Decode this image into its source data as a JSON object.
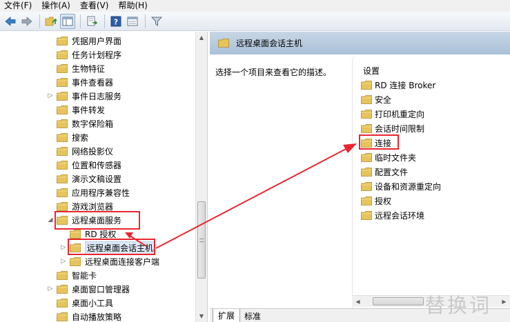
{
  "menu": [
    "文件(F)",
    "操作(A)",
    "查看(V)",
    "帮助(H)"
  ],
  "toolbar": {
    "icons": [
      "back-arrow-icon",
      "forward-arrow-icon",
      "up-folder-icon",
      "show-hide-tree-icon",
      "export-list-icon",
      "help-icon",
      "properties-icon",
      "filter-icon"
    ]
  },
  "tree": {
    "items": [
      {
        "label": "凭据用户界面",
        "expander": ""
      },
      {
        "label": "任务计划程序",
        "expander": ""
      },
      {
        "label": "生物特征",
        "expander": ""
      },
      {
        "label": "事件查看器",
        "expander": ""
      },
      {
        "label": "事件日志服务",
        "expander": "▷"
      },
      {
        "label": "事件转发",
        "expander": ""
      },
      {
        "label": "数字保险箱",
        "expander": ""
      },
      {
        "label": "搜索",
        "expander": ""
      },
      {
        "label": "网络投影仪",
        "expander": ""
      },
      {
        "label": "位置和传感器",
        "expander": ""
      },
      {
        "label": "演示文稿设置",
        "expander": ""
      },
      {
        "label": "应用程序兼容性",
        "expander": ""
      },
      {
        "label": "游戏浏览器",
        "expander": ""
      },
      {
        "label": "远程桌面服务",
        "expander": "◢"
      },
      {
        "label": "RD 授权",
        "expander": ""
      },
      {
        "label": "远程桌面会话主机",
        "expander": "▷"
      },
      {
        "label": "远程桌面连接客户端",
        "expander": "▷"
      },
      {
        "label": "智能卡",
        "expander": ""
      },
      {
        "label": "桌面窗口管理器",
        "expander": "▷"
      },
      {
        "label": "桌面小工具",
        "expander": ""
      },
      {
        "label": "自动播放策略",
        "expander": ""
      }
    ]
  },
  "header": {
    "title": "远程桌面会话主机"
  },
  "description": "选择一个项目来查看它的描述。",
  "settings": {
    "heading": "设置",
    "items": [
      "RD 连接 Broker",
      "安全",
      "打印机重定向",
      "会话时间限制",
      "连接",
      "临时文件夹",
      "配置文件",
      "设备和资源重定向",
      "授权",
      "远程会话环境"
    ]
  },
  "tabs": [
    "扩展",
    "标准"
  ],
  "watermark": "替换词",
  "colors": {
    "annotation": "#e8262f",
    "folder": "#e6c45c",
    "header": "#b8cbe0"
  }
}
